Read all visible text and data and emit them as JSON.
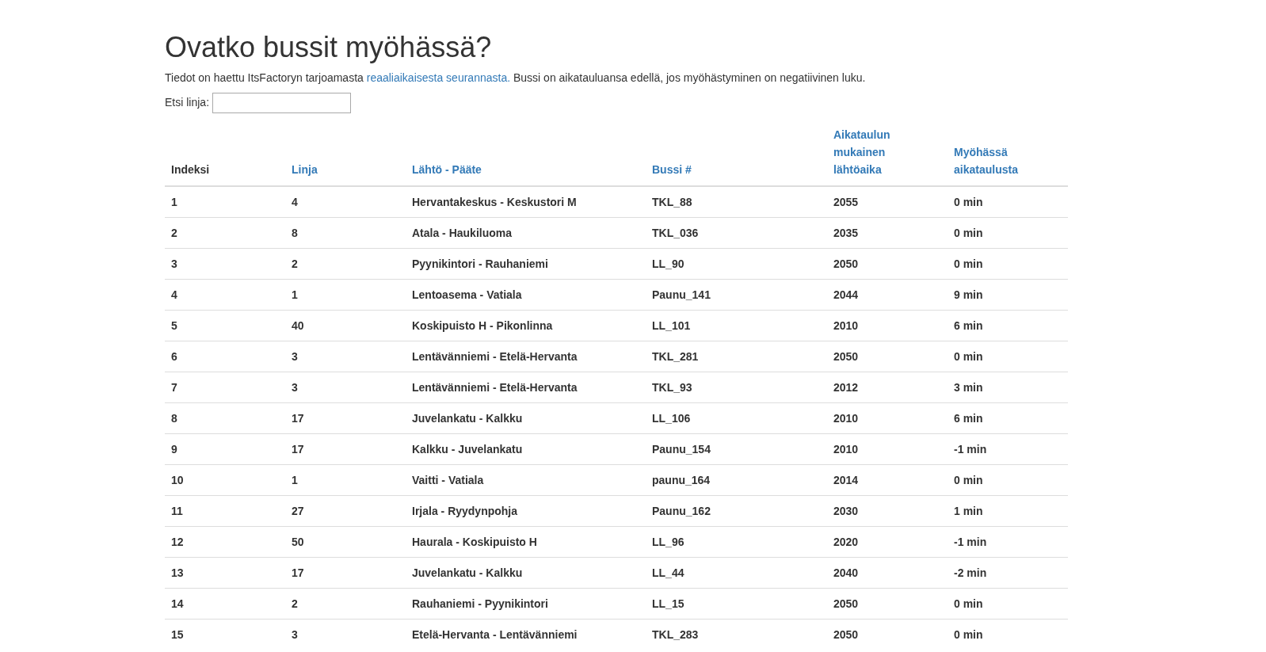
{
  "title": "Ovatko bussit myöhässä?",
  "intro": {
    "before": "Tiedot on haettu ItsFactoryn tarjoamasta ",
    "link": "reaaliaikaisesta seurannasta.",
    "after": " Bussi on aikatauluansa edellä, jos myöhästyminen on negatiivinen luku."
  },
  "search": {
    "label": "Etsi linja:"
  },
  "table": {
    "columns": [
      {
        "label": "Indeksi",
        "link": false
      },
      {
        "label": "Linja",
        "link": true
      },
      {
        "label": "Lähtö - Pääte",
        "link": true
      },
      {
        "label": "Bussi #",
        "link": true
      },
      {
        "label": "Aikataulun mukainen lähtöaika",
        "link": true
      },
      {
        "label": "Myöhässä aikataulusta",
        "link": true
      }
    ],
    "rows": [
      [
        "1",
        "4",
        "Hervantakeskus - Keskustori M",
        "TKL_88",
        "2055",
        "0 min"
      ],
      [
        "2",
        "8",
        "Atala - Haukiluoma",
        "TKL_036",
        "2035",
        "0 min"
      ],
      [
        "3",
        "2",
        "Pyynikintori - Rauhaniemi",
        "LL_90",
        "2050",
        "0 min"
      ],
      [
        "4",
        "1",
        "Lentoasema - Vatiala",
        "Paunu_141",
        "2044",
        "9 min"
      ],
      [
        "5",
        "40",
        "Koskipuisto H - Pikonlinna",
        "LL_101",
        "2010",
        "6 min"
      ],
      [
        "6",
        "3",
        "Lentävänniemi - Etelä-Hervanta",
        "TKL_281",
        "2050",
        "0 min"
      ],
      [
        "7",
        "3",
        "Lentävänniemi - Etelä-Hervanta",
        "TKL_93",
        "2012",
        "3 min"
      ],
      [
        "8",
        "17",
        "Juvelankatu - Kalkku",
        "LL_106",
        "2010",
        "6 min"
      ],
      [
        "9",
        "17",
        "Kalkku - Juvelankatu",
        "Paunu_154",
        "2010",
        "-1 min"
      ],
      [
        "10",
        "1",
        "Vaitti - Vatiala",
        "paunu_164",
        "2014",
        "0 min"
      ],
      [
        "11",
        "27",
        "Irjala - Ryydynpohja",
        "Paunu_162",
        "2030",
        "1 min"
      ],
      [
        "12",
        "50",
        "Haurala - Koskipuisto H",
        "LL_96",
        "2020",
        "-1 min"
      ],
      [
        "13",
        "17",
        "Juvelankatu - Kalkku",
        "LL_44",
        "2040",
        "-2 min"
      ],
      [
        "14",
        "2",
        "Rauhaniemi - Pyynikintori",
        "LL_15",
        "2050",
        "0 min"
      ],
      [
        "15",
        "3",
        "Etelä-Hervanta - Lentävänniemi",
        "TKL_283",
        "2050",
        "0 min"
      ]
    ]
  }
}
